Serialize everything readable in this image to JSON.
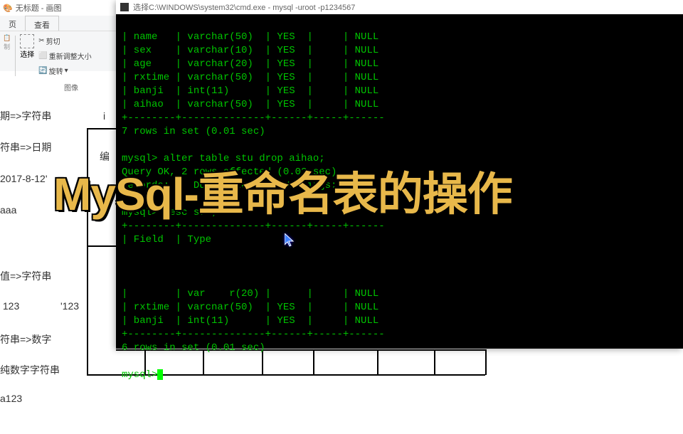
{
  "paint": {
    "title": "无标题 - 画图",
    "tabs": [
      "页",
      "查看"
    ],
    "cut": "剪切",
    "resize": "重新调整大小",
    "select": "选择",
    "rotate": "旋转",
    "image": "图像"
  },
  "terminal": {
    "title": "选择C:\\WINDOWS\\system32\\cmd.exe - mysql -uroot -p1234567",
    "table1": [
      [
        "name",
        "varchar(50)",
        "YES",
        "NULL"
      ],
      [
        "sex",
        "varchar(10)",
        "YES",
        "NULL"
      ],
      [
        "age",
        "varchar(20)",
        "YES",
        "NULL"
      ],
      [
        "rxtime",
        "varchar(50)",
        "YES",
        "NULL"
      ],
      [
        "banji",
        "int(11)",
        "YES",
        "NULL"
      ],
      [
        "aihao",
        "varchar(50)",
        "YES",
        "NULL"
      ]
    ],
    "rows1": "7 rows in set (0.01 sec)",
    "cmd1": "mysql> alter table stu drop aihao;",
    "result1a": "Query OK, 2 rows affected (0.02 sec)",
    "result1b": "Records: 2  Duplicates: 0  Warnings: 0",
    "cmd2": "mysql> desc stu;",
    "headers": "| Field  | Type",
    "table2": [
      [
        "",
        "var    r(20)",
        "",
        "NULL"
      ],
      [
        "rxtime",
        "varcnar(50)",
        "YES",
        "NULL"
      ],
      [
        "banji",
        "int(11)",
        "YES",
        "NULL"
      ]
    ],
    "rows2": "6 rows in set (0.01 sec)",
    "prompt": "mysql>"
  },
  "bg": {
    "t1": "期=>字符串",
    "t1b": "i",
    "t2": "符串=>日期",
    "t2b": "编",
    "t3": "2017-8-12'",
    "t4": "aaa",
    "t5": "值=>字符串",
    "t6": " 123",
    "t6b": "'123",
    "t7": "符串=>数字",
    "t8": "纯数字字符串",
    "t9": "a123"
  },
  "overlay": "MySql-重命名表的操作"
}
